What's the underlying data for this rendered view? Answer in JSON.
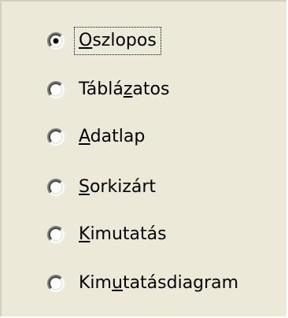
{
  "options": [
    {
      "label": "Oszlopos",
      "accel_index": 0,
      "selected": true,
      "focused": true
    },
    {
      "label": "Táblázatos",
      "accel_index": 5,
      "selected": false,
      "focused": false
    },
    {
      "label": "Adatlap",
      "accel_index": 0,
      "selected": false,
      "focused": false
    },
    {
      "label": "Sorkizárt",
      "accel_index": 0,
      "selected": false,
      "focused": false
    },
    {
      "label": "Kimutatás",
      "accel_index": 0,
      "selected": false,
      "focused": false
    },
    {
      "label": "Kimutatásdiagram",
      "accel_index": 3,
      "selected": false,
      "focused": false
    }
  ],
  "colors": {
    "panel_bg": "#ece9d8",
    "radio_fill": "#ffffff",
    "radio_dot": "#000000"
  }
}
